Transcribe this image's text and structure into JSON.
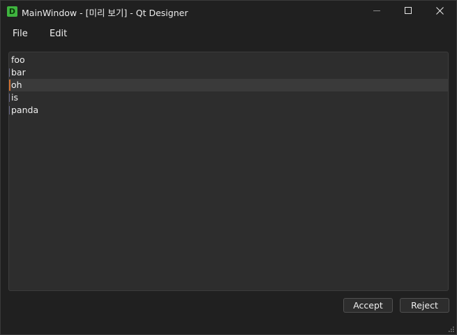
{
  "window": {
    "icon_letter": "D",
    "title": "MainWindow - [미리 보기] - Qt Designer"
  },
  "menubar": {
    "file": "File",
    "edit": "Edit"
  },
  "list": {
    "items": [
      "foo",
      "bar",
      "oh",
      "is",
      "panda"
    ],
    "selected_index": 2
  },
  "buttons": {
    "accept": "Accept",
    "reject": "Reject"
  },
  "colors": {
    "background": "#202020",
    "list_background": "#2d2d2d",
    "selection": "#3a3a3a",
    "selection_marker": "#d07030",
    "icon_green": "#3fb43f"
  }
}
